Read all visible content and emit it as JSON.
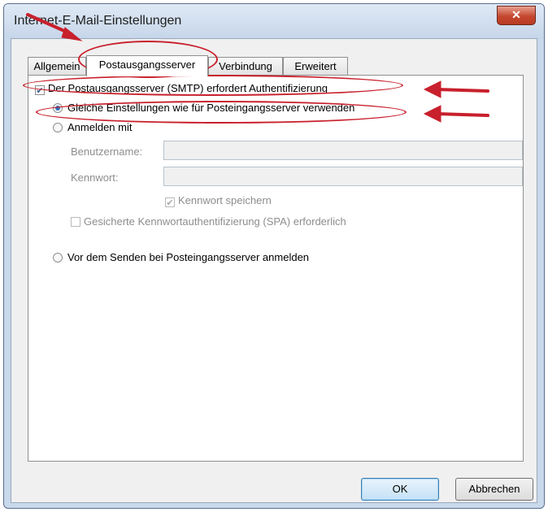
{
  "window": {
    "title": "Internet-E-Mail-Einstellungen",
    "close_glyph": "✕"
  },
  "tabs": [
    {
      "label": "Allgemein"
    },
    {
      "label": "Postausgangsserver"
    },
    {
      "label": "Verbindung"
    },
    {
      "label": "Erweitert"
    }
  ],
  "active_tab": "Postausgangsserver",
  "outgoing": {
    "smtp_auth_label": "Der Postausgangsserver (SMTP) erfordert Authentifizierung",
    "smtp_auth_checked": true,
    "same_settings_label": "Gleiche Einstellungen wie für Posteingangsserver verwenden",
    "same_settings_selected": true,
    "login_with_label": "Anmelden mit",
    "username_label": "Benutzername:",
    "username_value": "",
    "password_label": "Kennwort:",
    "password_value": "",
    "remember_password_label": "Kennwort speichern",
    "remember_password_checked": true,
    "spa_label": "Gesicherte Kennwortauthentifizierung (SPA) erforderlich",
    "spa_checked": false,
    "login_before_send_label": "Vor dem Senden bei Posteingangsserver anmelden"
  },
  "buttons": {
    "ok_label": "OK",
    "cancel_label": "Abbrechen"
  },
  "colors": {
    "annotation_red": "#c8202c",
    "radio_selected": "#2b6fc0"
  }
}
